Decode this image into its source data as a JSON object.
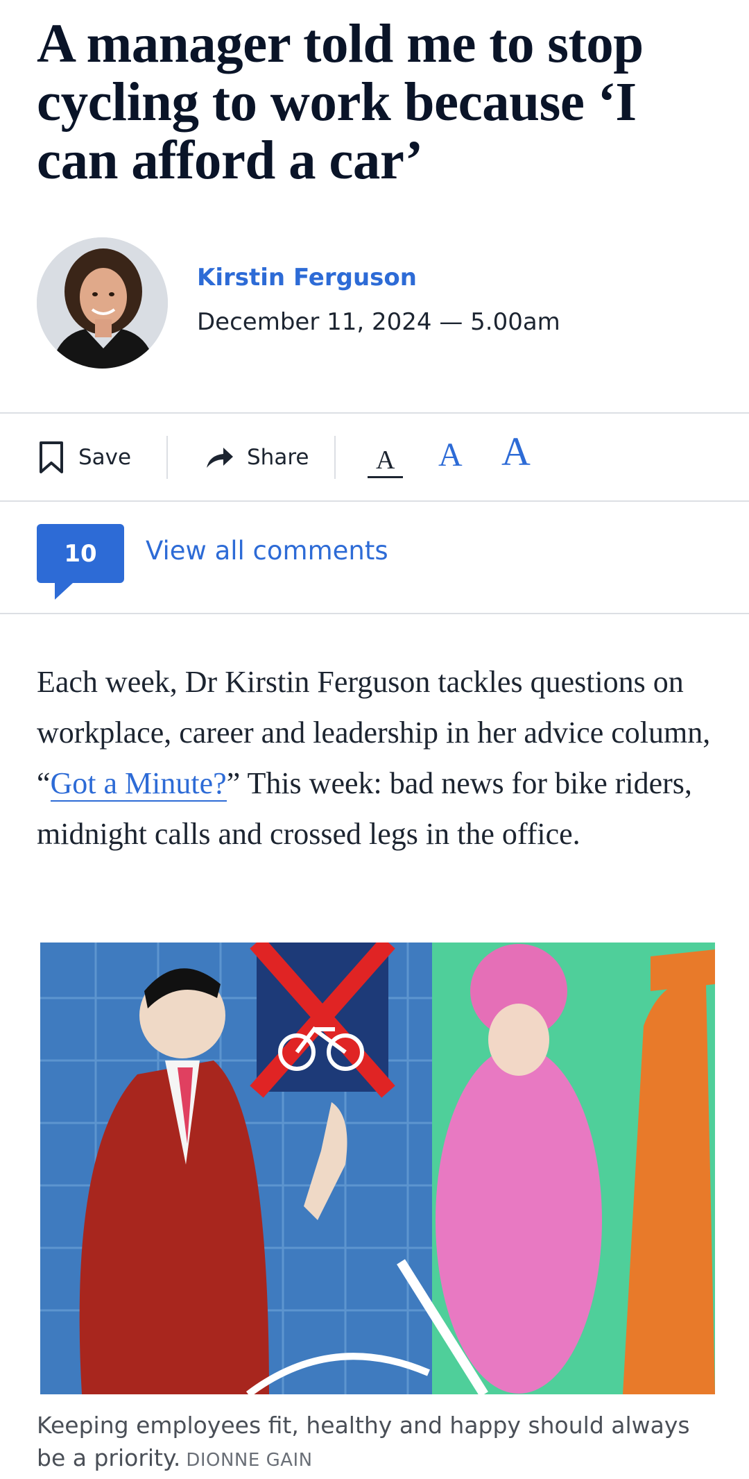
{
  "article": {
    "headline": "A manager told me to stop cycling to work because ‘I can afford a car’",
    "author": "Kirstin Ferguson",
    "date": "December 11, 2024 — 5.00am"
  },
  "toolbar": {
    "save_label": "Save",
    "share_label": "Share",
    "font_small": "A",
    "font_medium": "A",
    "font_large": "A"
  },
  "comments": {
    "count": "10",
    "link_label": "View all comments"
  },
  "body": {
    "intro_before": "Each week, Dr Kirstin Ferguson tackles questions on workplace, career and leadership in her advice column, “",
    "intro_link": "Got a Minute?",
    "intro_after": "” This week: bad news for bike riders, midnight calls and crossed legs in the office."
  },
  "image": {
    "caption": "Keeping employees fit, healthy and happy should always be a priority.",
    "credit": "DIONNE GAIN"
  },
  "colors": {
    "accent": "#2d6bd6",
    "headline": "#0a1428"
  }
}
